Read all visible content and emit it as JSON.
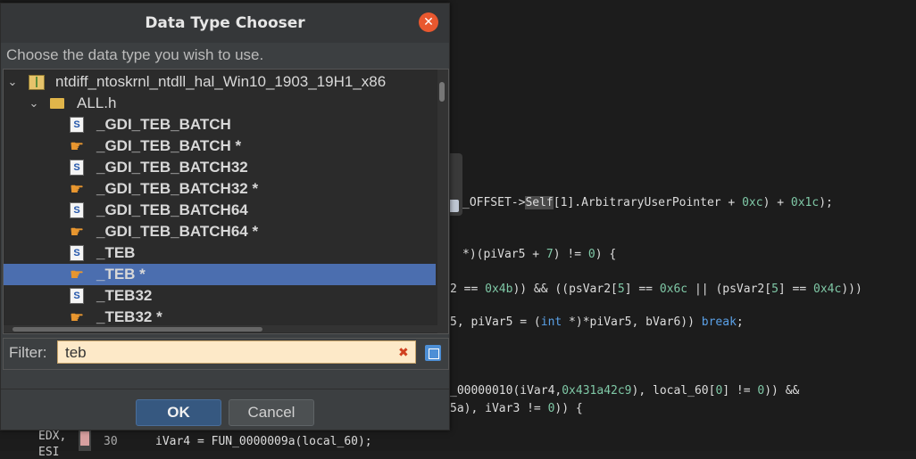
{
  "dialog": {
    "title": "Data Type Chooser",
    "instruction": "Choose the data type you wish to use.",
    "filter_label": "Filter:",
    "filter_value": "teb",
    "ok_label": "OK",
    "cancel_label": "Cancel"
  },
  "tree": {
    "root": "ntdiff_ntoskrnl_ntdll_hal_Win10_1903_19H1_x86",
    "folder": "ALL.h",
    "items": [
      {
        "label": "_GDI_TEB_BATCH",
        "icon": "structure-icon"
      },
      {
        "label": "_GDI_TEB_BATCH *",
        "icon": "pointer-icon"
      },
      {
        "label": "_GDI_TEB_BATCH32",
        "icon": "structure-icon"
      },
      {
        "label": "_GDI_TEB_BATCH32 *",
        "icon": "pointer-icon"
      },
      {
        "label": "_GDI_TEB_BATCH64",
        "icon": "structure-icon"
      },
      {
        "label": "_GDI_TEB_BATCH64 *",
        "icon": "pointer-icon"
      },
      {
        "label": "_TEB",
        "icon": "structure-icon"
      },
      {
        "label": "_TEB *",
        "icon": "pointer-icon",
        "selected": true
      },
      {
        "label": "_TEB32",
        "icon": "structure-icon"
      },
      {
        "label": "_TEB32 *",
        "icon": "pointer-icon"
      }
    ]
  },
  "background_code": {
    "line1_a": "_OFFSET->",
    "line1_b": "Self",
    "line1_c": "[1].ArbitraryUserPointer + ",
    "line1_d": "0xc",
    "line1_e": ") + ",
    "line1_f": "0x1c",
    "line1_g": ");",
    "line2_a": "*)(piVar5 + ",
    "line2_b": "7",
    "line2_c": ") != ",
    "line2_d": "0",
    "line2_e": ") {",
    "line3_a": "2 == ",
    "line3_b": "0x4b",
    "line3_c": ")) && ((psVar2[",
    "line3_d": "5",
    "line3_e": "] == ",
    "line3_f": "0x6c",
    "line3_g": " || (psVar2[",
    "line3_h": "5",
    "line3_i": "] == ",
    "line3_j": "0x4c",
    "line3_k": ")))",
    "line4_a": "5, piVar5 = (",
    "line4_b": "int",
    "line4_c": " *)*piVar5, bVar6)) ",
    "line4_d": "break",
    "line4_e": ";",
    "line5_a": "_00000010(iVar4,",
    "line5_b": "0x431a42c9",
    "line5_c": "), local_60[",
    "line5_d": "0",
    "line5_e": "] != ",
    "line5_f": "0",
    "line5_g": ")) &&",
    "line6_a": "5a), iVar3 != ",
    "line6_b": "0",
    "line6_c": ")) {",
    "line7_a": "iVar4 = FUN_0000009a(local_60);",
    "reg1": "EDX,",
    "reg2": "ESI",
    "line_number": "30"
  }
}
